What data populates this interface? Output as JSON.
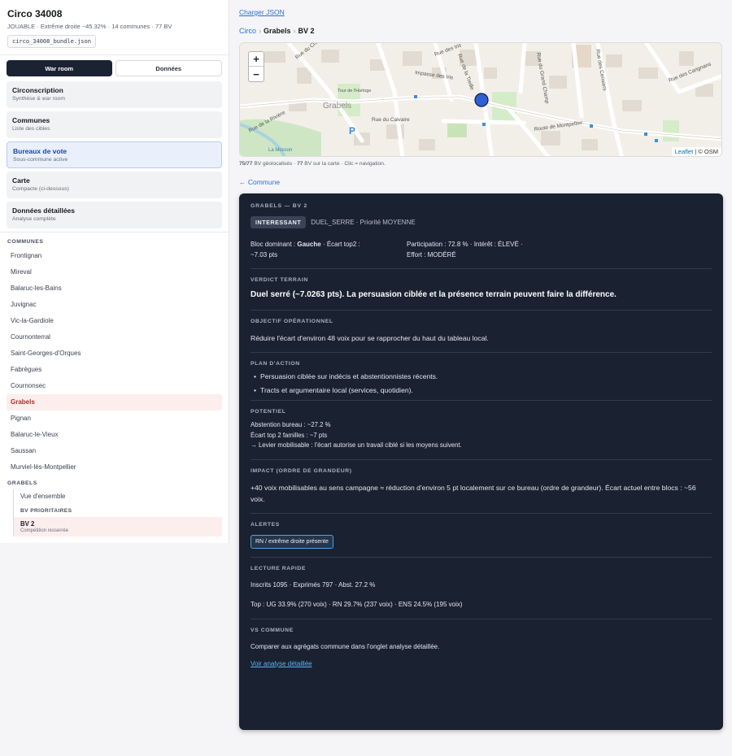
{
  "sidebar": {
    "title": "Circo 34008",
    "subtitle": "JOUABLE · Extrême droite ~45.32% · 14 communes · 77 BV",
    "file": "circo_34008_bundle.json",
    "tabs": [
      "War room",
      "Données"
    ],
    "nav": [
      {
        "title": "Circonscription",
        "sub": "Synthèse & war room"
      },
      {
        "title": "Communes",
        "sub": "Liste des cibles"
      },
      {
        "title": "Bureaux de vote",
        "sub": "Sous-commune active"
      },
      {
        "title": "Carte",
        "sub": "Compacte (ci-dessous)"
      },
      {
        "title": "Données détaillées",
        "sub": "Analyse complète"
      }
    ],
    "communes_label": "COMMUNES",
    "communes": [
      "Frontignan",
      "Mireval",
      "Balaruc-les-Bains",
      "Juvignac",
      "Vic-la-Gardiole",
      "Cournonterral",
      "Saint-Georges-d'Orques",
      "Fabrègues",
      "Cournonsec",
      "Grabels",
      "Pignan",
      "Balaruc-le-Vieux",
      "Saussan",
      "Murviel-lès-Montpellier"
    ],
    "sub_label": "GRABELS",
    "sub_overview": "Vue d'ensemble",
    "sub_priority_label": "BV PRIORITAIRES",
    "sub_active_title": "BV 2",
    "sub_active_sub": "Compétition resserrée"
  },
  "main": {
    "load_json": "Charger JSON",
    "crumb": [
      "Circo",
      "Grabels",
      "BV 2"
    ],
    "map_attrib_leaflet": "Leaflet",
    "map_attrib_osm": "| © OSM",
    "map_note_a": "75/77",
    "map_note_b": " BV géolocalisés · ",
    "map_note_c": "77",
    "map_note_d": " BV sur la carte · Clic = navigation.",
    "back": "← Commune",
    "map_labels": [
      "Rue du Château",
      "Impasse des Iris",
      "Rue des Iris",
      "Rue de la Treille",
      "Rue du Grand Champ",
      "Rue des Cerisiers",
      "Rue des Carignans",
      "Rue du Calvaire",
      "Route de Montpellier",
      "Grabels",
      "Rue de la Rivière",
      "Tour de l'Horloge",
      "La Mosson"
    ]
  },
  "panel": {
    "kicker": "GRABELS — BV 2",
    "badge": "INTERESSANT",
    "tag_text": "DUEL_SERRE · Priorité MOYENNE",
    "bloc_label": "Bloc dominant : ",
    "bloc_value": "Gauche",
    "bloc_rest": " · Écart top2 :",
    "bloc_line2": "~7.03 pts",
    "part_line1": "Participation : 72.8 % · Intérêt : ÉLEVÉ ·",
    "part_line2": "Effort : MODÉRÉ",
    "verdict_label": "VERDICT TERRAIN",
    "verdict": "Duel serré (~7.0263 pts). La persuasion ciblée et la présence terrain peuvent faire la différence.",
    "objectif_label": "OBJECTIF OPÉRATIONNEL",
    "objectif": "Réduire l'écart d'environ 48 voix pour se rapprocher du haut du tableau local.",
    "plan_label": "PLAN D'ACTION",
    "plan": [
      "Persuasion ciblée sur indécis et abstentionnistes récents.",
      "Tracts et argumentaire local (services, quotidien)."
    ],
    "potentiel_label": "POTENTIEL",
    "potentiel": [
      "Abstention bureau : ~27.2 %",
      "Écart top 2 familles : ~7 pts",
      "→ Levier mobilisable : l'écart autorise un travail ciblé si les moyens suivent."
    ],
    "impact_label": "IMPACT (ORDRE DE GRANDEUR)",
    "impact": "+40 voix mobilisables au sens campagne ≈ réduction d'environ 5 pt localement sur ce bureau (ordre de grandeur). Écart actuel entre blocs : ~56 voix.",
    "alertes_label": "ALERTES",
    "alerte_chip": "RN / extrême droite présente",
    "lecture_label": "LECTURE RAPIDE",
    "lecture_1": "Inscrits 1095 · Exprimés 797 · Abst. 27.2 %",
    "lecture_2": "Top : UG 33.9% (270 voix) · RN 29.7% (237 voix) · ENS 24.5% (195 voix)",
    "vs_label": "VS COMMUNE",
    "vs_text": "Comparer aux agrégats commune dans l'onglet analyse détaillée.",
    "vs_link": "Voir analyse détaillée"
  }
}
